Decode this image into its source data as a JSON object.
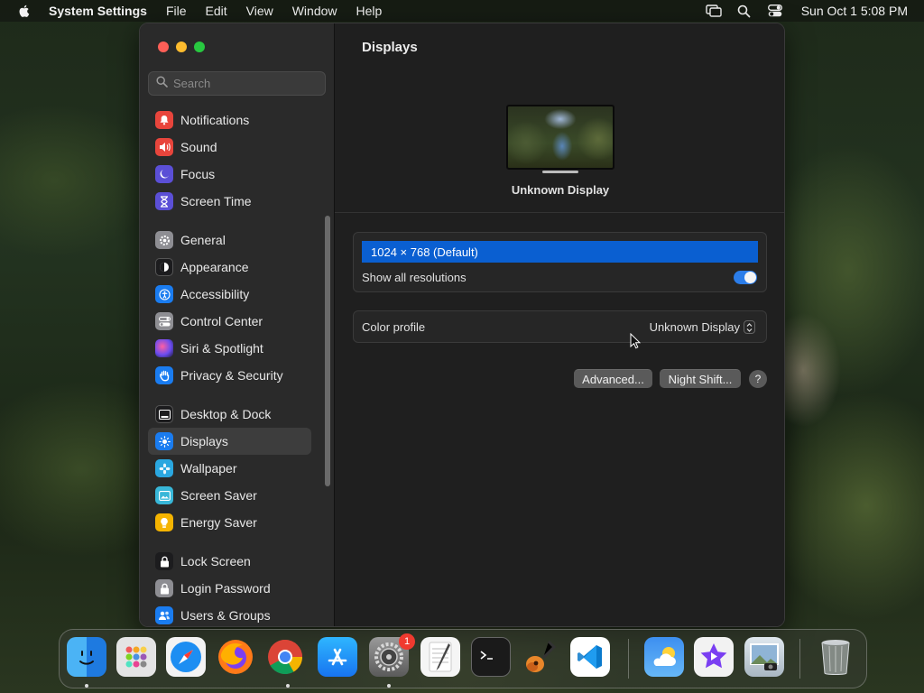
{
  "menubar": {
    "app_name": "System Settings",
    "items": [
      "File",
      "Edit",
      "View",
      "Window",
      "Help"
    ],
    "clock": "Sun Oct 1  5:08 PM"
  },
  "sidebar": {
    "search_placeholder": "Search",
    "items": [
      {
        "label": "Notifications",
        "icon": "bell-icon",
        "color": "#e8453c"
      },
      {
        "label": "Sound",
        "icon": "speaker-icon",
        "color": "#e8453c"
      },
      {
        "label": "Focus",
        "icon": "moon-icon",
        "color": "#5b4fd6"
      },
      {
        "label": "Screen Time",
        "icon": "hourglass-icon",
        "color": "#5b4fd6"
      },
      {
        "label": "General",
        "icon": "gear-icon",
        "color": "#8e8e93"
      },
      {
        "label": "Appearance",
        "icon": "appearance-icon",
        "color": "#1c1c1e"
      },
      {
        "label": "Accessibility",
        "icon": "accessibility-icon",
        "color": "#1a7cf0"
      },
      {
        "label": "Control Center",
        "icon": "control-center-icon",
        "color": "#8e8e93"
      },
      {
        "label": "Siri & Spotlight",
        "icon": "siri-icon",
        "color": "#b44fd6"
      },
      {
        "label": "Privacy & Security",
        "icon": "hand-icon",
        "color": "#1a7cf0"
      },
      {
        "label": "Desktop & Dock",
        "icon": "dock-icon",
        "color": "#1c1c1e"
      },
      {
        "label": "Displays",
        "icon": "sun-icon",
        "color": "#1a7cf0"
      },
      {
        "label": "Wallpaper",
        "icon": "flower-icon",
        "color": "#2aa7e0"
      },
      {
        "label": "Screen Saver",
        "icon": "screen-saver-icon",
        "color": "#38b7d8"
      },
      {
        "label": "Energy Saver",
        "icon": "bulb-icon",
        "color": "#f5b400"
      },
      {
        "label": "Lock Screen",
        "icon": "lock-icon",
        "color": "#1c1c1e"
      },
      {
        "label": "Login Password",
        "icon": "login-lock-icon",
        "color": "#8e8e93"
      },
      {
        "label": "Users & Groups",
        "icon": "users-icon",
        "color": "#1a7cf0"
      }
    ],
    "selected": "Displays"
  },
  "content": {
    "title": "Displays",
    "display_name": "Unknown Display",
    "resolution_selected": "1024 × 768 (Default)",
    "show_all_resolutions_label": "Show all resolutions",
    "show_all_resolutions_on": true,
    "color_profile_label": "Color profile",
    "color_profile_value": "Unknown Display",
    "advanced_button": "Advanced...",
    "night_shift_button": "Night Shift...",
    "help_button": "?"
  },
  "dock": {
    "apps": [
      {
        "name": "Finder",
        "icon": "finder-icon",
        "running": true
      },
      {
        "name": "Launchpad",
        "icon": "launchpad-icon",
        "running": false
      },
      {
        "name": "Safari",
        "icon": "safari-icon",
        "running": false
      },
      {
        "name": "Firefox",
        "icon": "firefox-icon",
        "running": false
      },
      {
        "name": "Chrome",
        "icon": "chrome-icon",
        "running": true
      },
      {
        "name": "App Store",
        "icon": "app-store-icon",
        "running": false
      },
      {
        "name": "System Settings",
        "icon": "system-settings-icon",
        "running": true,
        "badge": "1"
      },
      {
        "name": "TextEdit",
        "icon": "textedit-icon",
        "running": false
      },
      {
        "name": "Terminal",
        "icon": "terminal-icon",
        "running": false
      },
      {
        "name": "GarageBand",
        "icon": "garageband-icon",
        "running": false
      },
      {
        "name": "VS Code",
        "icon": "vscode-icon",
        "running": false
      },
      {
        "name": "Weather",
        "icon": "weather-icon",
        "running": false
      },
      {
        "name": "iMovie",
        "icon": "imovie-icon",
        "running": false
      },
      {
        "name": "Preview",
        "icon": "preview-icon",
        "running": false
      },
      {
        "name": "Trash",
        "icon": "trash-icon",
        "running": false
      }
    ]
  }
}
